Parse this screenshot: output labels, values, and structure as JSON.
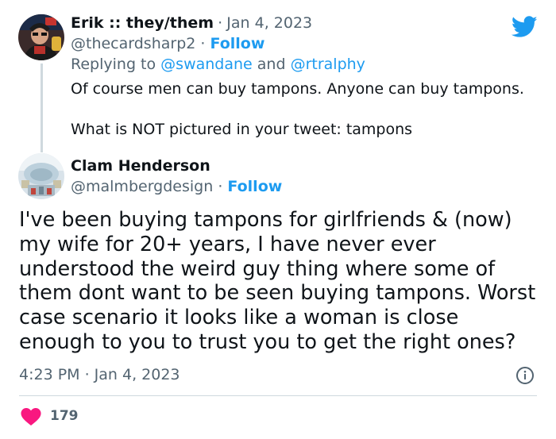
{
  "reply_tweet": {
    "author_name": "Erik :: they/them",
    "date": "Jan 4, 2023",
    "handle": "@thecardsharp2",
    "follow_label": "Follow",
    "replying_prefix": "Replying to",
    "replying_to": [
      "@swandane",
      "@rtralphy"
    ],
    "replying_and": "and",
    "text_lines": [
      "Of course men can buy tampons. Anyone can buy tampons.",
      "What is NOT pictured in your tweet: tampons"
    ]
  },
  "main_tweet": {
    "author_name": "Clam Henderson",
    "handle": "@malmbergdesign",
    "follow_label": "Follow",
    "text_lines": [
      "I've been buying tampons for girlfriends & (now)",
      "my wife for 20+ years, I have never ever",
      "understood the weird guy thing where some of",
      "them dont want to be seen buying tampons. Worst",
      "case scenario it looks like a woman is close",
      "enough to you to trust you to get the right ones?"
    ],
    "timestamp": "4:23 PM · Jan 4, 2023",
    "like_count": "179"
  },
  "separator": "·",
  "colors": {
    "twitter_blue": "#1d9bf0",
    "like_red": "#f91880",
    "secondary_text": "#536471"
  },
  "icons": [
    "twitter-bird-icon",
    "info-icon",
    "heart-icon"
  ]
}
